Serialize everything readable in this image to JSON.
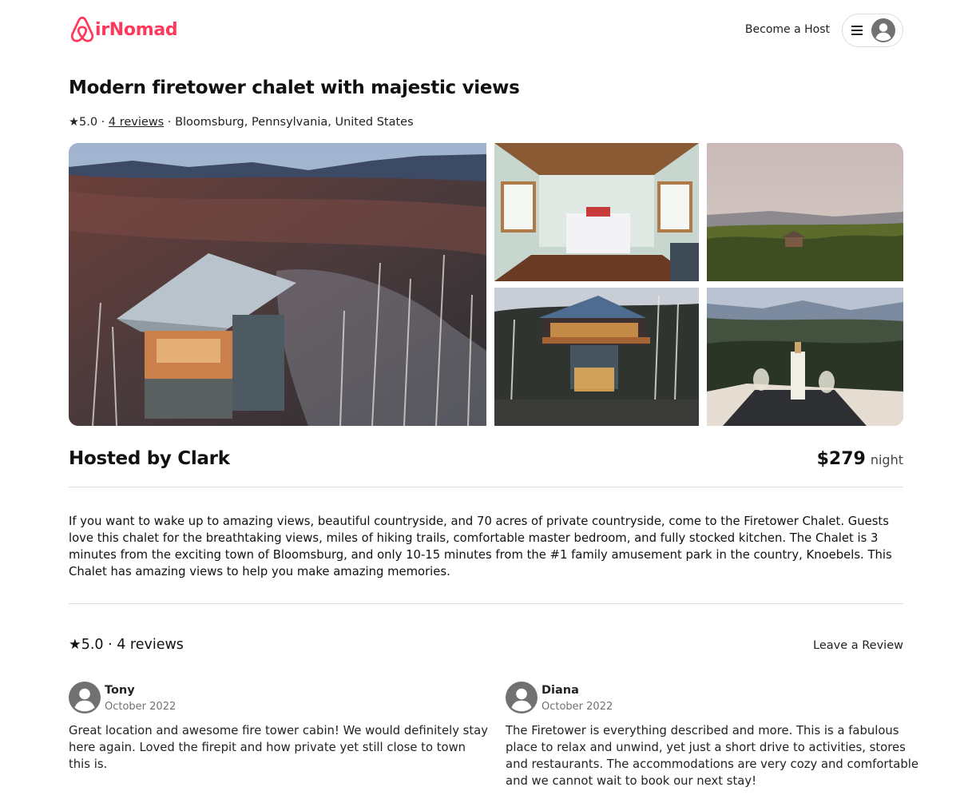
{
  "header": {
    "logo_text": "irNomad",
    "become_host_label": "Become a Host",
    "brand_color": "#ff385c"
  },
  "listing": {
    "title": "Modern firetower chalet with majestic views",
    "rating": "★5.0",
    "separator": "·",
    "reviews_link": "4 reviews",
    "location": "Bloomsburg, Pennsylvania, United States"
  },
  "gallery": {
    "photos": [
      {
        "name": "photo-aerial-firetower",
        "subject": "aerial view of firetower chalet among birch forest"
      },
      {
        "name": "photo-bedroom",
        "subject": "bedroom interior with wooden beams"
      },
      {
        "name": "photo-tower-in-forest",
        "subject": "tower in green forest at dusk"
      },
      {
        "name": "photo-tower-lit-evening",
        "subject": "firetower lit up at evening"
      },
      {
        "name": "photo-wine-on-deck",
        "subject": "wine bottle and glasses on deck overlooking valley"
      }
    ]
  },
  "host": {
    "hosted_by": "Hosted by Clark",
    "price": "$279",
    "price_unit": "night"
  },
  "description": "If you want to wake up to amazing views, beautiful countryside, and 70 acres of private countryside, come to the Firetower Chalet. Guests love this chalet for the breathtaking views, miles of hiking trails, comfortable master bedroom, and fully stocked kitchen. The Chalet is 3 minutes from the exciting town of Bloomsburg, and only 10-15 minutes from the #1 family amusement park in the country, Knoebels. This Chalet has amazing views to help you make amazing memories.",
  "reviews": {
    "summary": "★5.0 · 4 reviews",
    "leave_review_label": "Leave a Review",
    "items": [
      {
        "name": "Tony",
        "date": "October 2022",
        "text": "Great location and awesome fire tower cabin! We would definitely stay here again. Loved the firepit and how private yet still close to town this is."
      },
      {
        "name": "Diana",
        "date": "October 2022",
        "text": "The Firetower is everything described and more. This is a fabulous place to relax and unwind, yet just a short drive to activities, stores and restaurants. The accommodations are very cozy and comfortable and we cannot wait to book our next stay!"
      }
    ]
  }
}
